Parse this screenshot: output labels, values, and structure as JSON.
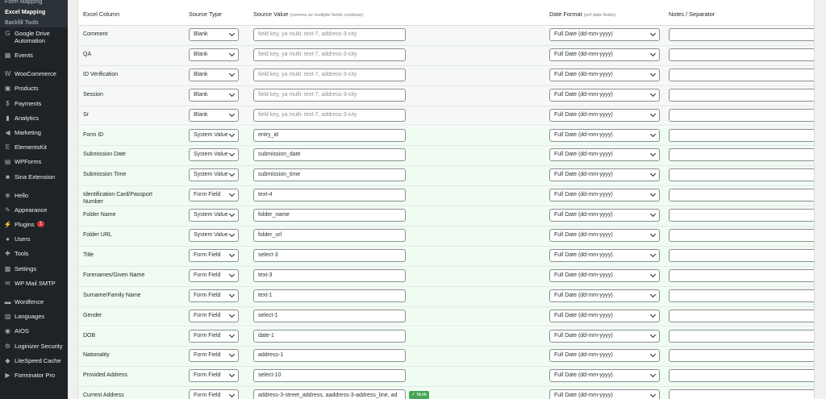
{
  "sidebar": {
    "submenu": [
      {
        "label": "Form Mapping",
        "current": false
      },
      {
        "label": "Excel Mapping",
        "current": true
      },
      {
        "label": "Backfill Tools",
        "current": false
      }
    ],
    "items": [
      {
        "label": "Google Drive Automation",
        "icon": "google-drive-icon",
        "glyph": "G",
        "tall": true,
        "gap": false
      },
      {
        "label": "Events",
        "icon": "calendar-icon",
        "glyph": "▦",
        "tall": false,
        "gap": false
      },
      {
        "label": "WooCommerce",
        "icon": "woocommerce-icon",
        "glyph": "W",
        "tall": false,
        "gap": true
      },
      {
        "label": "Products",
        "icon": "box-icon",
        "glyph": "▣",
        "tall": false,
        "gap": false
      },
      {
        "label": "Payments",
        "icon": "dollar-icon",
        "glyph": "$",
        "tall": false,
        "gap": false
      },
      {
        "label": "Analytics",
        "icon": "bar-chart-icon",
        "glyph": "▮",
        "tall": false,
        "gap": false
      },
      {
        "label": "Marketing",
        "icon": "megaphone-icon",
        "glyph": "◀",
        "tall": false,
        "gap": false
      },
      {
        "label": "ElementsKit",
        "icon": "elementskit-icon",
        "glyph": "E",
        "tall": false,
        "gap": false
      },
      {
        "label": "WPForms",
        "icon": "wpforms-icon",
        "glyph": "▤",
        "tall": false,
        "gap": false
      },
      {
        "label": "Sina Extension",
        "icon": "sina-icon",
        "glyph": "■",
        "tall": false,
        "gap": false
      },
      {
        "label": "Hello",
        "icon": "plus-circle-icon",
        "glyph": "⊕",
        "tall": false,
        "gap": true
      },
      {
        "label": "Appearance",
        "icon": "paintbrush-icon",
        "glyph": "✎",
        "tall": false,
        "gap": false
      },
      {
        "label": "Plugins",
        "icon": "plug-icon",
        "glyph": "⚡",
        "tall": false,
        "gap": false,
        "badge": "1"
      },
      {
        "label": "Users",
        "icon": "user-icon",
        "glyph": "●",
        "tall": false,
        "gap": false
      },
      {
        "label": "Tools",
        "icon": "wrench-icon",
        "glyph": "✚",
        "tall": false,
        "gap": false
      },
      {
        "label": "Settings",
        "icon": "settings-icon",
        "glyph": "▩",
        "tall": false,
        "gap": false
      },
      {
        "label": "WP Mail SMTP",
        "icon": "mail-icon",
        "glyph": "✉",
        "tall": false,
        "gap": false
      },
      {
        "label": "Wordfence",
        "icon": "wordfence-icon",
        "glyph": "▬",
        "tall": false,
        "gap": true
      },
      {
        "label": "Languages",
        "icon": "languages-icon",
        "glyph": "▧",
        "tall": false,
        "gap": false
      },
      {
        "label": "AIOS",
        "icon": "aios-icon",
        "glyph": "◉",
        "tall": false,
        "gap": false
      },
      {
        "label": "Loginizer Security",
        "icon": "gear-icon",
        "glyph": "⚙",
        "tall": false,
        "gap": false
      },
      {
        "label": "LiteSpeed Cache",
        "icon": "diamond-icon",
        "glyph": "◆",
        "tall": false,
        "gap": false
      },
      {
        "label": "Forminator Pro",
        "icon": "forminator-icon",
        "glyph": "▶",
        "tall": false,
        "gap": false
      }
    ]
  },
  "table": {
    "headers": {
      "excel_column": "Excel Column",
      "source_type": "Source Type",
      "source_value": "Source Value",
      "source_value_hint": "(comma se multiple fields combine)",
      "date_format": "Date Format",
      "date_format_hint": "(sirf date fields)",
      "notes": "Notes / Separator"
    },
    "placeholder": "field key, ya multi: text-7, address-3-city",
    "rows": [
      {
        "label": "Comment",
        "source": "Blank",
        "value": "",
        "date": "Full Date (dd-mm-yyyy)",
        "notes": ""
      },
      {
        "label": "QA",
        "source": "Blank",
        "value": "",
        "date": "Full Date (dd-mm-yyyy)",
        "notes": ""
      },
      {
        "label": "ID Verification",
        "source": "Blank",
        "value": "",
        "date": "Full Date (dd-mm-yyyy)",
        "notes": ""
      },
      {
        "label": "Session",
        "source": "Blank",
        "value": "",
        "date": "Full Date (dd-mm-yyyy)",
        "notes": ""
      },
      {
        "label": "Sr",
        "source": "Blank",
        "value": "",
        "date": "Full Date (dd-mm-yyyy)",
        "notes": ""
      },
      {
        "label": "Form ID",
        "source": "System Value",
        "value": "entry_id",
        "date": "Full Date (dd-mm-yyyy)",
        "notes": ""
      },
      {
        "label": "Submission Date",
        "source": "System Value",
        "value": "submission_date",
        "date": "Full Date (dd-mm-yyyy)",
        "notes": ""
      },
      {
        "label": "Submission Time",
        "source": "System Value",
        "value": "submission_time",
        "date": "Full Date (dd-mm-yyyy)",
        "notes": ""
      },
      {
        "label": "Identification Card/Passport Number",
        "source": "Form Field",
        "value": "text-4",
        "date": "Full Date (dd-mm-yyyy)",
        "notes": ""
      },
      {
        "label": "Folder Name",
        "source": "System Value",
        "value": "folder_name",
        "date": "Full Date (dd-mm-yyyy)",
        "notes": ""
      },
      {
        "label": "Folder URL",
        "source": "System Value",
        "value": "folder_url",
        "date": "Full Date (dd-mm-yyyy)",
        "notes": ""
      },
      {
        "label": "Title",
        "source": "Form Field",
        "value": "select-3",
        "date": "Full Date (dd-mm-yyyy)",
        "notes": ""
      },
      {
        "label": "Forenames/Given Name",
        "source": "Form Field",
        "value": "text-3",
        "date": "Full Date (dd-mm-yyyy)",
        "notes": ""
      },
      {
        "label": "Surname/Family Name",
        "source": "Form Field",
        "value": "text-1",
        "date": "Full Date (dd-mm-yyyy)",
        "notes": ""
      },
      {
        "label": "Gender",
        "source": "Form Field",
        "value": "select-1",
        "date": "Full Date (dd-mm-yyyy)",
        "notes": ""
      },
      {
        "label": "DOB",
        "source": "Form Field",
        "value": "date-1",
        "date": "Full Date (dd-mm-yyyy)",
        "notes": ""
      },
      {
        "label": "Nationality",
        "source": "Form Field",
        "value": "address-1",
        "date": "Full Date (dd-mm-yyyy)",
        "notes": ""
      },
      {
        "label": "Provided Address",
        "source": "Form Field",
        "value": "select-10",
        "date": "Full Date (dd-mm-yyyy)",
        "notes": ""
      },
      {
        "label": "Current Address",
        "source": "Form Field",
        "value": "address-3-street_address, aaddress-3-address_line, ad",
        "date": "Full Date (dd-mm-yyyy)",
        "notes": "",
        "multi_badge": "✓ Multi"
      }
    ]
  },
  "colors": {
    "sidebar_bg": "#1d2327",
    "submenu_bg": "#2c3338",
    "mapped_row": "#f0fbf2",
    "blank_row": "#f6f7f7",
    "multi_badge": "#46a556",
    "plugin_badge": "#d63638"
  }
}
